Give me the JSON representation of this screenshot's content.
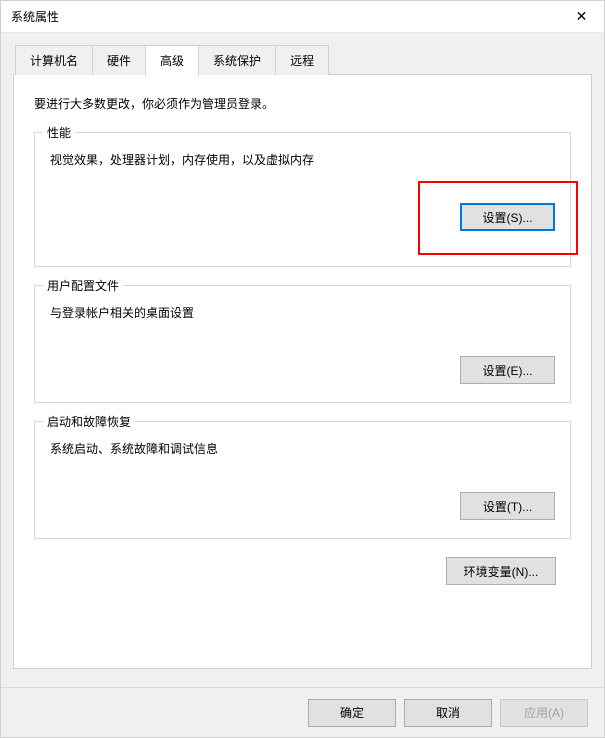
{
  "window": {
    "title": "系统属性"
  },
  "tabs": {
    "computer_name": "计算机名",
    "hardware": "硬件",
    "advanced": "高级",
    "system_protection": "系统保护",
    "remote": "远程"
  },
  "intro": "要进行大多数更改，你必须作为管理员登录。",
  "sections": {
    "performance": {
      "title": "性能",
      "desc": "视觉效果，处理器计划，内存使用，以及虚拟内存",
      "button": "设置(S)..."
    },
    "user_profiles": {
      "title": "用户配置文件",
      "desc": "与登录帐户相关的桌面设置",
      "button": "设置(E)..."
    },
    "startup_recovery": {
      "title": "启动和故障恢复",
      "desc": "系统启动、系统故障和调试信息",
      "button": "设置(T)..."
    }
  },
  "env_button": "环境变量(N)...",
  "buttons": {
    "ok": "确定",
    "cancel": "取消",
    "apply": "应用(A)"
  }
}
